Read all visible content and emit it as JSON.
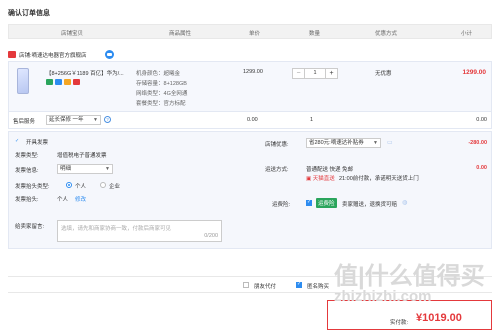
{
  "page": {
    "title": "确认订单信息"
  },
  "table_header": {
    "store_product": "店铺宝贝",
    "attributes": "商品属性",
    "unit_price": "单价",
    "quantity": "数量",
    "discount": "优惠方式",
    "subtotal": "小计"
  },
  "shop": {
    "label": "店铺:",
    "name": "嘀速达电器官方旗舰店"
  },
  "product": {
    "name": "【8+256G￥1189 百亿】华为/...",
    "attr_color": "机身颜色：",
    "attr_color_val": "超曦金",
    "attr_storage": "存储容量：",
    "attr_storage_val": "8+128GB",
    "attr_network": "网络类型：",
    "attr_network_val": "4G全网通",
    "attr_package": "套餐类型：",
    "attr_package_val": "官方标配",
    "price": "1299.00",
    "qty": "1",
    "minus": "−",
    "plus": "+",
    "discount": "无优惠",
    "subtotal": "1299.00"
  },
  "service": {
    "label": "售后服务",
    "select": "延长保修 一年",
    "price": "0.00",
    "qty": "1",
    "subtotal": "0.00"
  },
  "invoice": {
    "toggle_label": "开具发票",
    "type_label": "发票类型:",
    "type_value": "增值税电子普通发票",
    "content_label": "发票信息:",
    "content_value": "明细",
    "header_type_label": "发票抬头类型:",
    "header_person": "个人",
    "header_company": "企业",
    "header_label": "发票抬头:",
    "header_value": "个人",
    "header_edit": "修改"
  },
  "message": {
    "label": "给卖家留言:",
    "placeholder": "选填，请先和商家协商一致，付款后商家可见",
    "counter": "0/200"
  },
  "store_discount": {
    "label": "店铺优惠:",
    "select": "省280元:嘀速达补贴券",
    "amount": "-280.00"
  },
  "delivery": {
    "label": "运送方式:",
    "method": "普通配送 快递 免邮",
    "note_brand": "天猫直送",
    "note": "21:00前付款，承诺明天送货上门",
    "amount": "0.00"
  },
  "insurance": {
    "label": "运费险:",
    "badge": "运费险",
    "text": "卖家赠送，退换货可赔"
  },
  "bottom": {
    "friend_pay": "朋友代付",
    "anonymous": "匿名购买"
  },
  "pay": {
    "label": "实付款:",
    "currency": "¥",
    "amount": "1019.00"
  },
  "watermark": {
    "logo": "值|什么值得买",
    "url": "zhizhizhi.com"
  }
}
